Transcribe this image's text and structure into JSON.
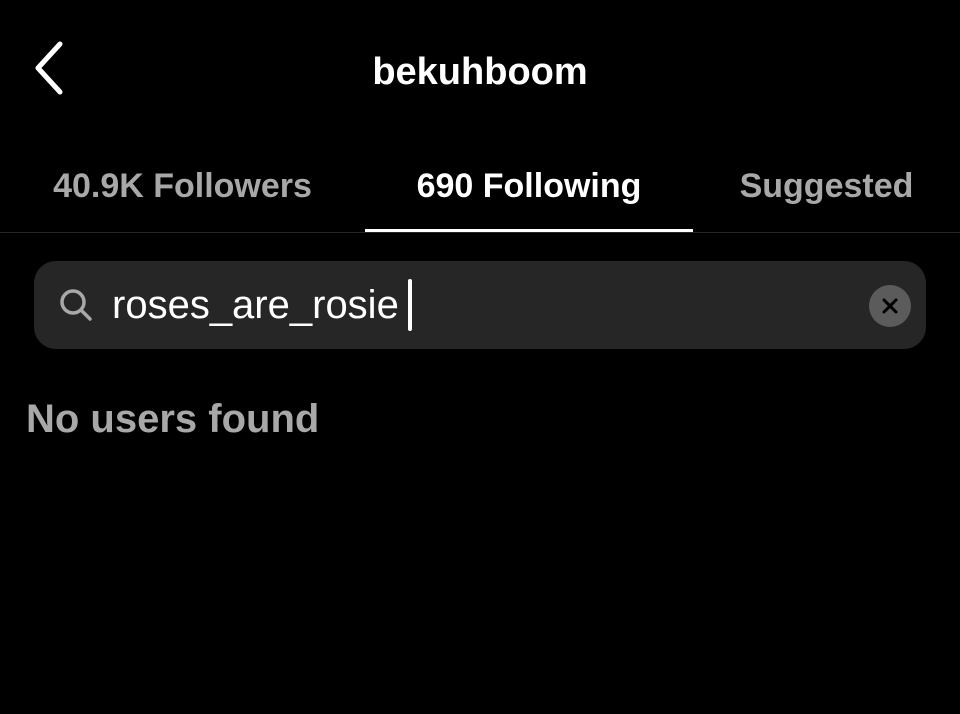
{
  "header": {
    "title": "bekuhboom",
    "back_icon": "chevron-left-icon"
  },
  "tabs": [
    {
      "label": "40.9K Followers",
      "active": false
    },
    {
      "label": "690 Following",
      "active": true
    },
    {
      "label": "Suggested",
      "active": false
    }
  ],
  "search": {
    "value": "roses_are_rosie",
    "icon": "search-icon",
    "clear_icon": "clear-icon"
  },
  "results": {
    "empty_message": "No users found"
  },
  "colors": {
    "background": "#000000",
    "search_background": "#262626",
    "text_primary": "#ffffff",
    "text_secondary": "#a8a8a8",
    "clear_button": "#5b5b5b"
  }
}
